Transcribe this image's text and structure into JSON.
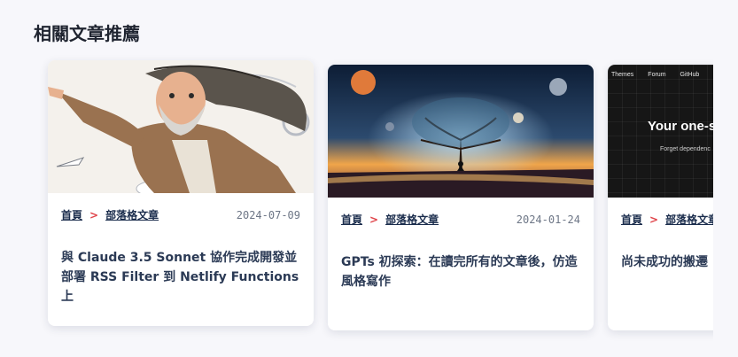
{
  "section": {
    "title": "相關文章推薦"
  },
  "cards": [
    {
      "image_icon": "illustration-image",
      "breadcrumb": {
        "home": "首頁",
        "separator": ">",
        "category": "部落格文章"
      },
      "date": "2024-07-09",
      "title": "與 Claude 3.5 Sonnet 協作完成開發並部署 RSS Filter 到 Netlify Functions 上"
    },
    {
      "image_icon": "cosmic-tree-image",
      "breadcrumb": {
        "home": "首頁",
        "separator": ">",
        "category": "部落格文章"
      },
      "date": "2024-01-24",
      "title": "GPTs 初探索：在讀完所有的文章後，仿造風格寫作"
    },
    {
      "image_icon": "website-screenshot-image",
      "site_nav": [
        "Themes",
        "Forum",
        "GitHub"
      ],
      "site_hero": "Your one-s",
      "site_sub": "Forget dependenc",
      "breadcrumb": {
        "home": "首頁",
        "separator": ">",
        "category": "部落格文章"
      },
      "title": "尚未成功的搬遷 (Wordpress) 趣"
    }
  ],
  "colors": {
    "accent": "#e0444a",
    "link": "#1b2d4d",
    "title": "#2b3a55",
    "background": "#f7f7fb"
  }
}
